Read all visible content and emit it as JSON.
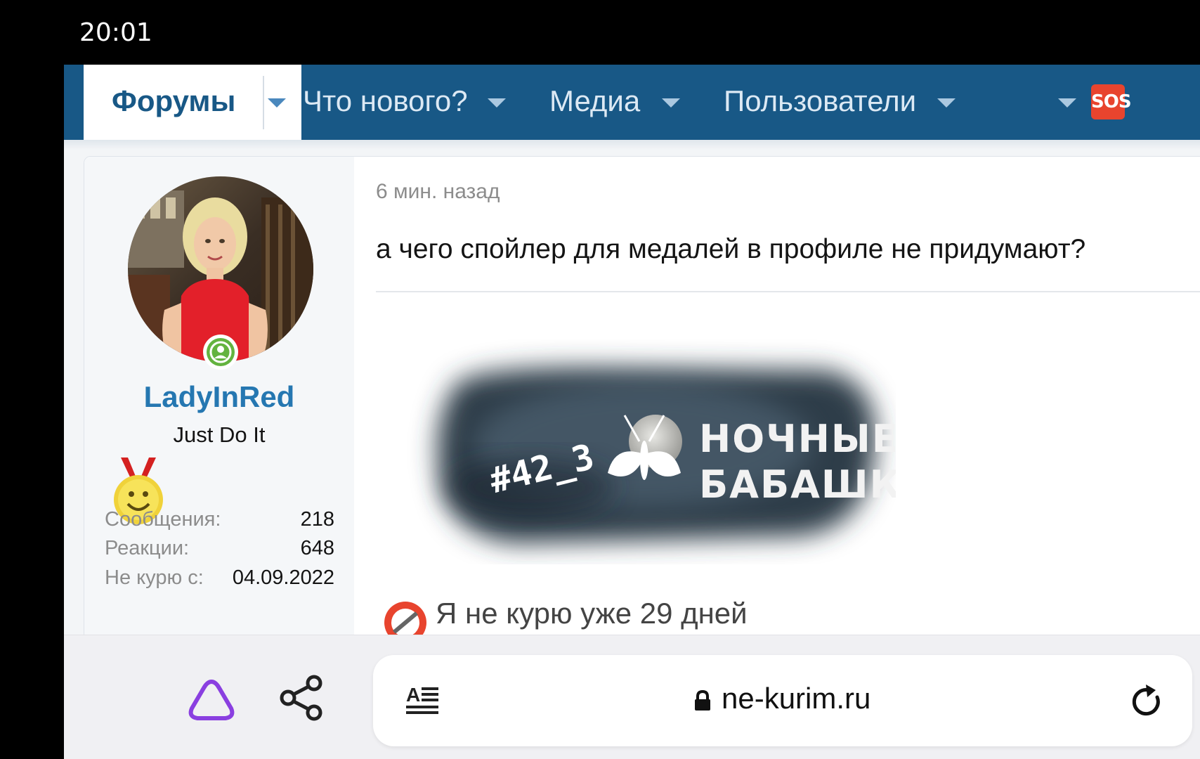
{
  "status_bar": {
    "time": "20:01"
  },
  "nav": {
    "forums": "Форумы",
    "whats_new": "Что нового?",
    "media": "Медиа",
    "members": "Пользователи",
    "sos_icon": "sos-icon",
    "colors": {
      "bar": "#185886",
      "active_text": "#185886"
    }
  },
  "user": {
    "name": "LadyInRed",
    "title": "Just Do It",
    "online_icon": "user-online-icon",
    "medal_icon": "smiley-medal-icon",
    "stats": [
      {
        "label": "Сообщения:",
        "value": "218"
      },
      {
        "label": "Реакции:",
        "value": "648"
      },
      {
        "label": "Не курю с:",
        "value": "04.09.2022"
      }
    ]
  },
  "post": {
    "time": "6 мин. назад",
    "text": "а чего спойлер для медалей в профиле не придумают?",
    "signature_banner": {
      "tag": "#42_3",
      "line1": "НОЧНЫЕ",
      "line2": "БАБАШКИ"
    },
    "signature_text": "Я не курю уже 29 дней"
  },
  "browser": {
    "url": "ne-kurim.ru",
    "icons": [
      "alice-icon",
      "share-icon",
      "reader-mode-icon",
      "lock-icon",
      "reload-icon"
    ]
  }
}
